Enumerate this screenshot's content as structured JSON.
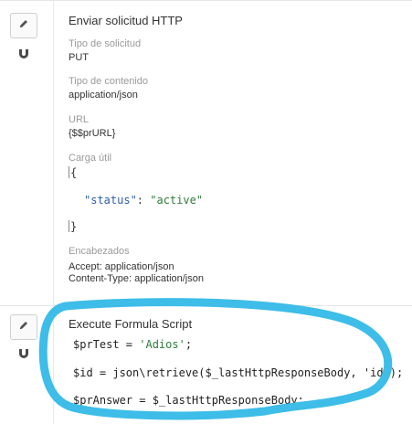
{
  "step1": {
    "title": "Enviar solicitud HTTP",
    "fields": [
      {
        "label": "Tipo de solicitud",
        "value": "PUT"
      },
      {
        "label": "Tipo de contenido",
        "value": "application/json"
      },
      {
        "label": "URL",
        "value": "{$$prURL}"
      }
    ],
    "payload": {
      "label": "Carga útil",
      "open_brace": "{",
      "key": "\"status\"",
      "colon": ": ",
      "val": "\"active\"",
      "close_brace": "}"
    },
    "headers": {
      "label": "Encabezados",
      "lines": [
        "Accept: application/json",
        "Content-Type: application/json"
      ]
    }
  },
  "step2": {
    "title": "Execute Formula Script",
    "lines": [
      {
        "code": "$prTest = ",
        "str": "'Adios'",
        "tail": ";"
      },
      {
        "code": "$id = json\\retrieve($_lastHttpResponseBody, 'id');",
        "str": "",
        "tail": ""
      },
      {
        "code": "$prAnswer = $_lastHttpResponseBody;",
        "str": "",
        "tail": ""
      }
    ]
  },
  "icons": {
    "edit": "pencil-icon",
    "connector": "magnet-icon"
  },
  "colors": {
    "highlight": "#3dbde8"
  }
}
